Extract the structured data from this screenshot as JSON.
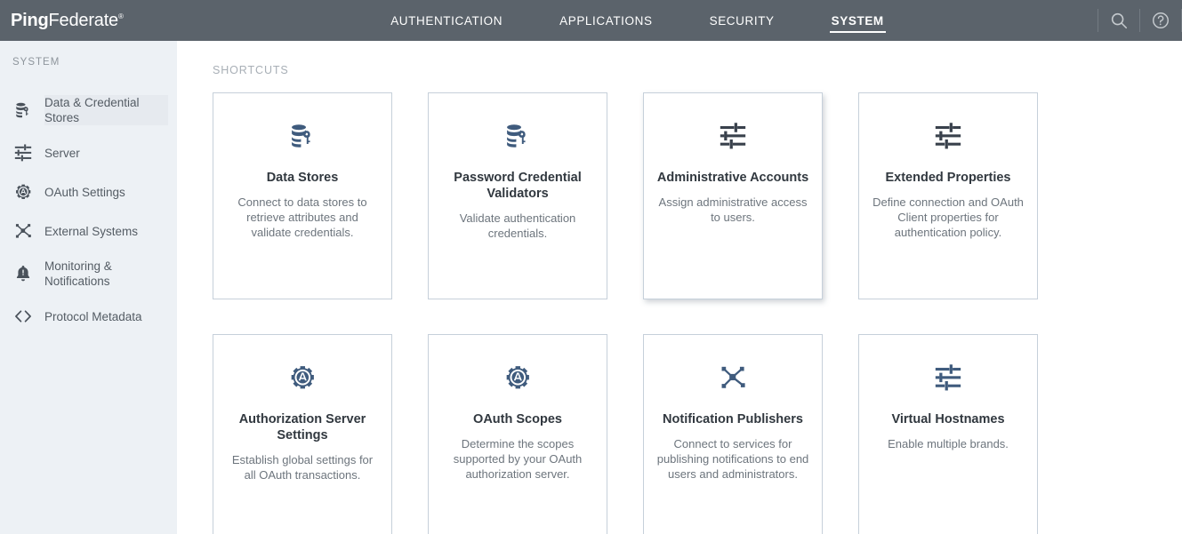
{
  "brand": {
    "name_bold": "Ping",
    "name_light": "Federate",
    "trademark": "®"
  },
  "topnav": {
    "items": [
      {
        "label": "AUTHENTICATION",
        "active": false
      },
      {
        "label": "APPLICATIONS",
        "active": false
      },
      {
        "label": "SECURITY",
        "active": false
      },
      {
        "label": "SYSTEM",
        "active": true
      }
    ],
    "search_icon": "search-icon",
    "help_icon": "help-icon"
  },
  "sidebar": {
    "title": "SYSTEM",
    "items": [
      {
        "label": "Data & Credential Stores",
        "icon": "database-key-icon"
      },
      {
        "label": "Server",
        "icon": "sliders-icon"
      },
      {
        "label": "OAuth Settings",
        "icon": "gear-a-icon"
      },
      {
        "label": "External Systems",
        "icon": "network-nodes-icon"
      },
      {
        "label": "Monitoring & Notifications",
        "icon": "bell-alert-icon"
      },
      {
        "label": "Protocol Metadata",
        "icon": "code-brackets-icon"
      }
    ]
  },
  "main": {
    "section_label": "SHORTCUTS",
    "cards": [
      {
        "title": "Data Stores",
        "description": "Connect to data stores to retrieve attributes and validate credentials.",
        "icon": "database-key-icon",
        "hovered": false
      },
      {
        "title": "Password Credential Validators",
        "description": "Validate authentication credentials.",
        "icon": "database-key-icon",
        "hovered": false
      },
      {
        "title": "Administrative Accounts",
        "description": "Assign administrative access to users.",
        "icon": "sliders-icon",
        "hovered": true
      },
      {
        "title": "Extended Properties",
        "description": "Define connection and OAuth Client properties for authentication policy.",
        "icon": "sliders-icon",
        "hovered": false
      },
      {
        "title": "Authorization Server Settings",
        "description": "Establish global settings for all OAuth transactions.",
        "icon": "gear-a-icon",
        "hovered": false
      },
      {
        "title": "OAuth Scopes",
        "description": "Determine the scopes supported by your OAuth authorization server.",
        "icon": "gear-a-icon",
        "hovered": false
      },
      {
        "title": "Notification Publishers",
        "description": "Connect to services for publishing notifications to end users and administrators.",
        "icon": "network-nodes-icon",
        "hovered": false
      },
      {
        "title": "Virtual Hostnames",
        "description": "Enable multiple brands.",
        "icon": "sliders-icon",
        "hovered": false
      }
    ]
  },
  "colors": {
    "topbar_bg": "#5b636b",
    "sidebar_bg": "#edf1f5",
    "card_border": "#c6d0da",
    "card_icon_blue": "#3f5b7d",
    "card_icon_slate": "#39414c",
    "title_text": "#31383f",
    "desc_text": "#6d757d"
  }
}
